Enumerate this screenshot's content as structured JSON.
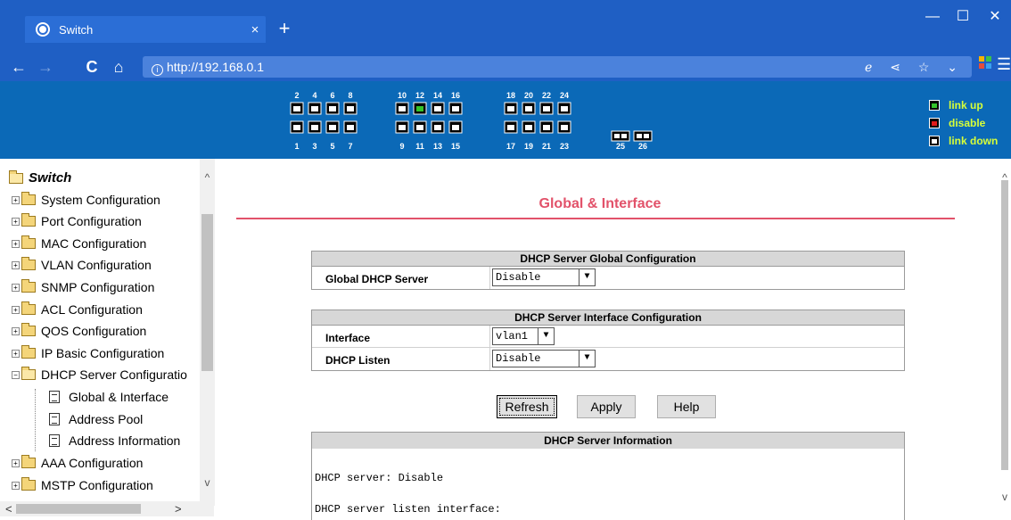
{
  "browser": {
    "tab_title": "Switch",
    "tab_close": "×",
    "new_tab": "+",
    "url": "http://192.168.0.1",
    "controls": {
      "minimize": "—",
      "maximize": "☐",
      "close": "✕"
    },
    "nav": {
      "back": "←",
      "forward": "→",
      "reload": "C",
      "home": "⌂"
    },
    "url_icons": "ℯ ⋖ ☆ ⌄",
    "menu": "☰"
  },
  "ports": {
    "top_labels": [
      "2",
      "4",
      "6",
      "8",
      "10",
      "12",
      "14",
      "16",
      "18",
      "20",
      "22",
      "24"
    ],
    "bottom_labels": [
      "1",
      "3",
      "5",
      "7",
      "9",
      "11",
      "13",
      "15",
      "17",
      "19",
      "21",
      "23",
      "25",
      "26"
    ],
    "up_port": "12",
    "legend": {
      "up": "link up",
      "disable": "disable",
      "down": "link down"
    },
    "colors": {
      "banner": "#0b69b7",
      "link_up": "#33c42a",
      "disable": "#e01b1b",
      "legend_text": "#d8ff38"
    }
  },
  "tree": {
    "root": "Switch",
    "items": [
      "System Configuration",
      "Port Configuration",
      "MAC Configuration",
      "VLAN Configuration",
      "SNMP Configuration",
      "ACL Configuration",
      "QOS Configuration",
      "IP Basic Configuration",
      "DHCP Server Configuratio"
    ],
    "leaves": [
      "Global & Interface",
      "Address Pool",
      "Address Information"
    ],
    "items_after": [
      "AAA Configuration",
      "MSTP Configuration"
    ],
    "expand_plus": "+",
    "expand_minus": "−"
  },
  "main": {
    "title": "Global & Interface",
    "global_section": {
      "heading": "DHCP Server Global Configuration",
      "label": "Global DHCP Server",
      "value": "Disable"
    },
    "interface_section": {
      "heading": "DHCP Server Interface Configuration",
      "interface_label": "Interface",
      "interface_value": "vlan1",
      "listen_label": "DHCP Listen",
      "listen_value": "Disable"
    },
    "buttons": {
      "refresh": "Refresh",
      "apply": "Apply",
      "help": "Help"
    },
    "info": {
      "heading": "DHCP Server Information",
      "line1": "DHCP server: Disable",
      "line2": "DHCP server listen interface:"
    },
    "dropdown_arrow": "▼"
  },
  "scroll": {
    "up": "^",
    "down": "v",
    "left": "<",
    "right": ">"
  }
}
